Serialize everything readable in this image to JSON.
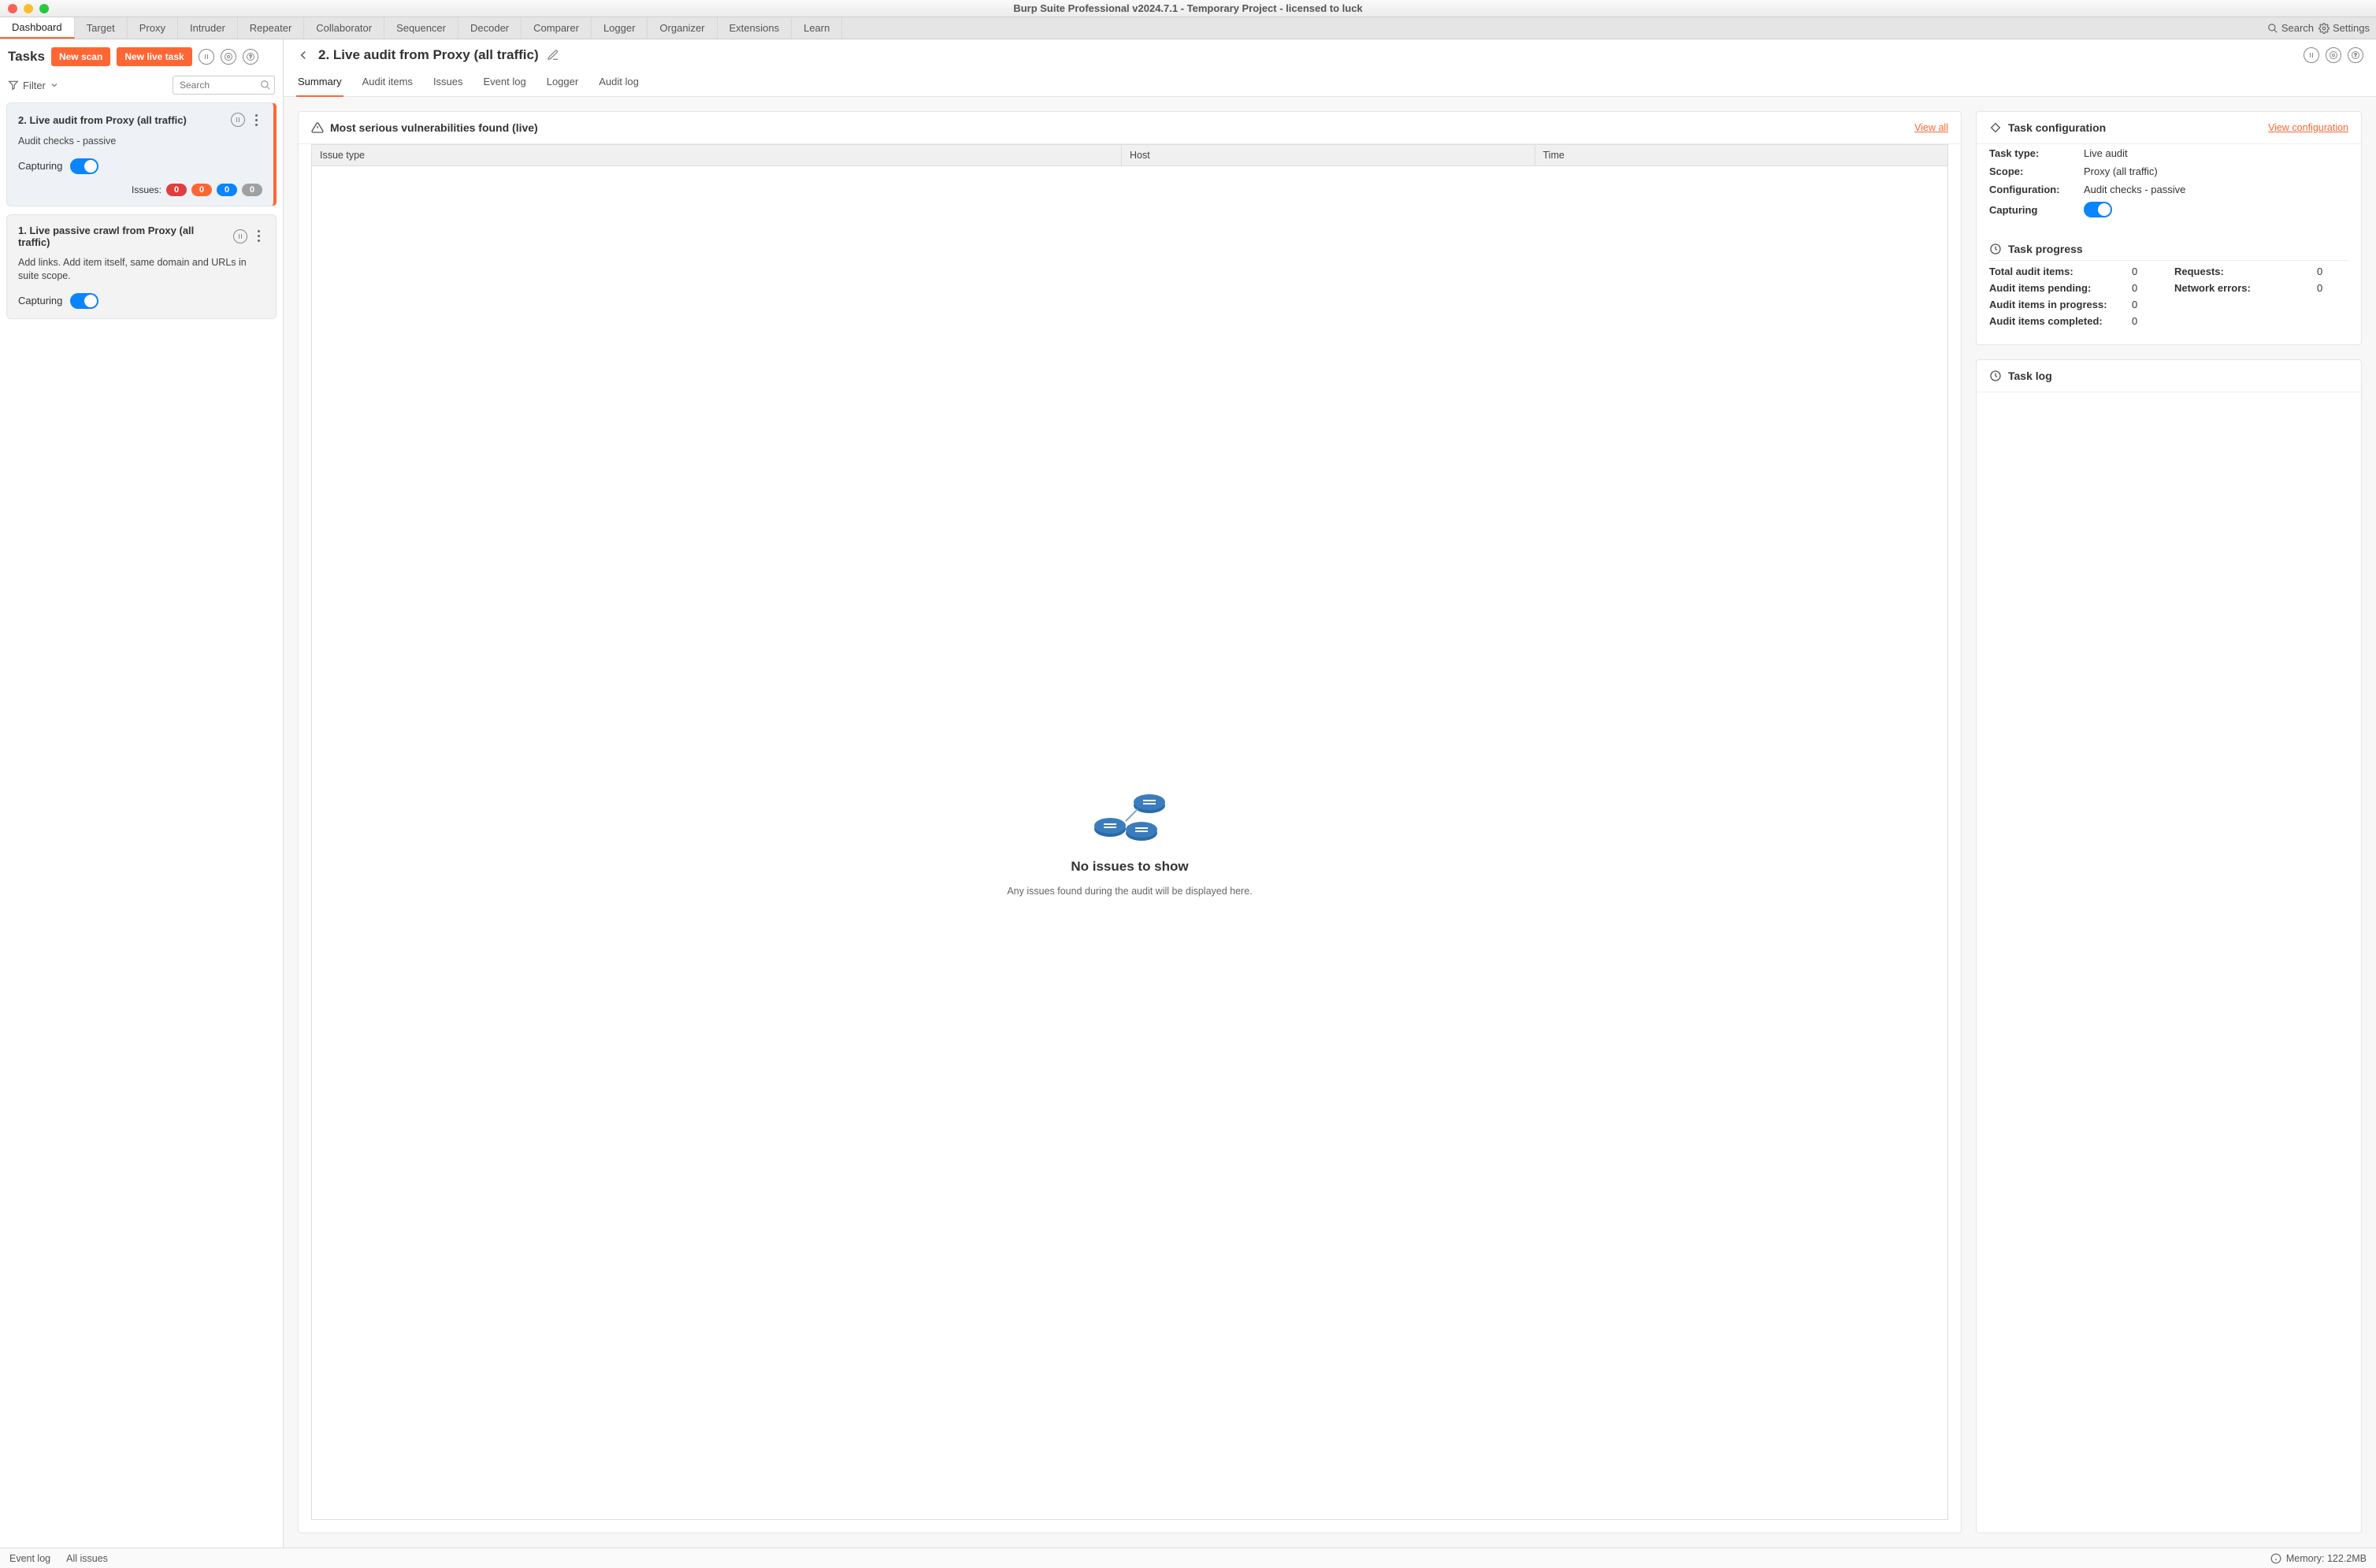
{
  "window": {
    "title": "Burp Suite Professional v2024.7.1 - Temporary Project - licensed to luck"
  },
  "maintabs": [
    "Dashboard",
    "Target",
    "Proxy",
    "Intruder",
    "Repeater",
    "Collaborator",
    "Sequencer",
    "Decoder",
    "Comparer",
    "Logger",
    "Organizer",
    "Extensions",
    "Learn"
  ],
  "maintab_active": "Dashboard",
  "toolbar_right": {
    "search": "Search",
    "settings": "Settings"
  },
  "sidebar": {
    "title": "Tasks",
    "new_scan": "New scan",
    "new_live_task": "New live task",
    "filter": "Filter",
    "search_placeholder": "Search"
  },
  "tasks": [
    {
      "title": "2. Live audit from Proxy (all traffic)",
      "desc": "Audit checks - passive",
      "capturing_label": "Capturing",
      "selected": true,
      "issues_label": "Issues:",
      "issues": {
        "critical": "0",
        "high": "0",
        "medium": "0",
        "info": "0"
      }
    },
    {
      "title": "1. Live passive crawl from Proxy (all traffic)",
      "desc": "Add links. Add item itself, same domain and URLs in suite scope.",
      "capturing_label": "Capturing",
      "selected": false
    }
  ],
  "main": {
    "title": "2. Live audit from Proxy (all traffic)",
    "subtabs": [
      "Summary",
      "Audit items",
      "Issues",
      "Event log",
      "Logger",
      "Audit log"
    ],
    "subtab_active": "Summary",
    "vuln_panel": {
      "title": "Most serious vulnerabilities found (live)",
      "view_all": "View all",
      "columns": {
        "issue": "Issue type",
        "host": "Host",
        "time": "Time"
      },
      "empty_title": "No issues to show",
      "empty_desc": "Any issues found during the audit will be displayed here."
    },
    "config_panel": {
      "title": "Task configuration",
      "view_link": "View configuration",
      "rows": {
        "task_type_k": "Task type:",
        "task_type_v": "Live audit",
        "scope_k": "Scope:",
        "scope_v": "Proxy (all traffic)",
        "config_k": "Configuration:",
        "config_v": "Audit checks - passive",
        "capturing_k": "Capturing"
      }
    },
    "progress_panel": {
      "title": "Task progress",
      "total_k": "Total audit items:",
      "total_v": "0",
      "pending_k": "Audit items pending:",
      "pending_v": "0",
      "inprog_k": "Audit items in progress:",
      "inprog_v": "0",
      "completed_k": "Audit items completed:",
      "completed_v": "0",
      "requests_k": "Requests:",
      "requests_v": "0",
      "neterr_k": "Network errors:",
      "neterr_v": "0"
    },
    "tasklog_title": "Task log"
  },
  "statusbar": {
    "event_log": "Event log",
    "all_issues": "All issues",
    "memory": "Memory: 122.2MB"
  }
}
